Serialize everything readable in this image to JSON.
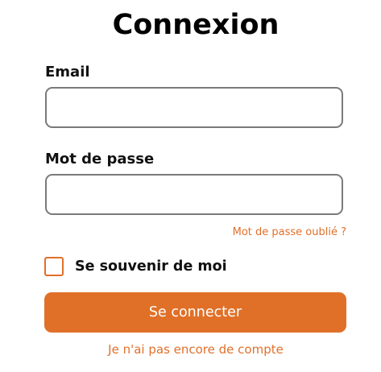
{
  "form": {
    "title": "Connexion",
    "email": {
      "label": "Email",
      "value": "",
      "placeholder": ""
    },
    "password": {
      "label": "Mot de passe",
      "value": "",
      "placeholder": ""
    },
    "forgot_password_link": "Mot de passe oublié ?",
    "remember_me": {
      "label": "Se souvenir de moi",
      "checked": false
    },
    "submit_label": "Se connecter",
    "signup_link": "Je n'ai pas encore de compte"
  },
  "colors": {
    "accent": "#e07028",
    "input_border": "#7a7a7a",
    "text": "#111111",
    "background": "#ffffff"
  }
}
